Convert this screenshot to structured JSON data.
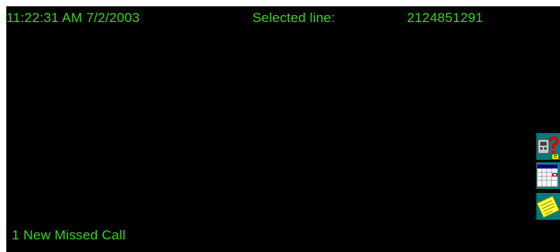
{
  "status": {
    "datetime": "11:22:31 AM 7/2/2003",
    "selected_line_label": "Selected line:",
    "selected_line_value": "2124851291"
  },
  "notification": {
    "missed_calls": "1 New Missed Call"
  },
  "side_icons": [
    {
      "name": "phone-help-icon"
    },
    {
      "name": "calendar-icon"
    },
    {
      "name": "notes-icon"
    }
  ],
  "colors": {
    "background": "#000000",
    "text": "#39d41b",
    "icon_bg": "#007b7b",
    "accent_red": "#e00000"
  }
}
